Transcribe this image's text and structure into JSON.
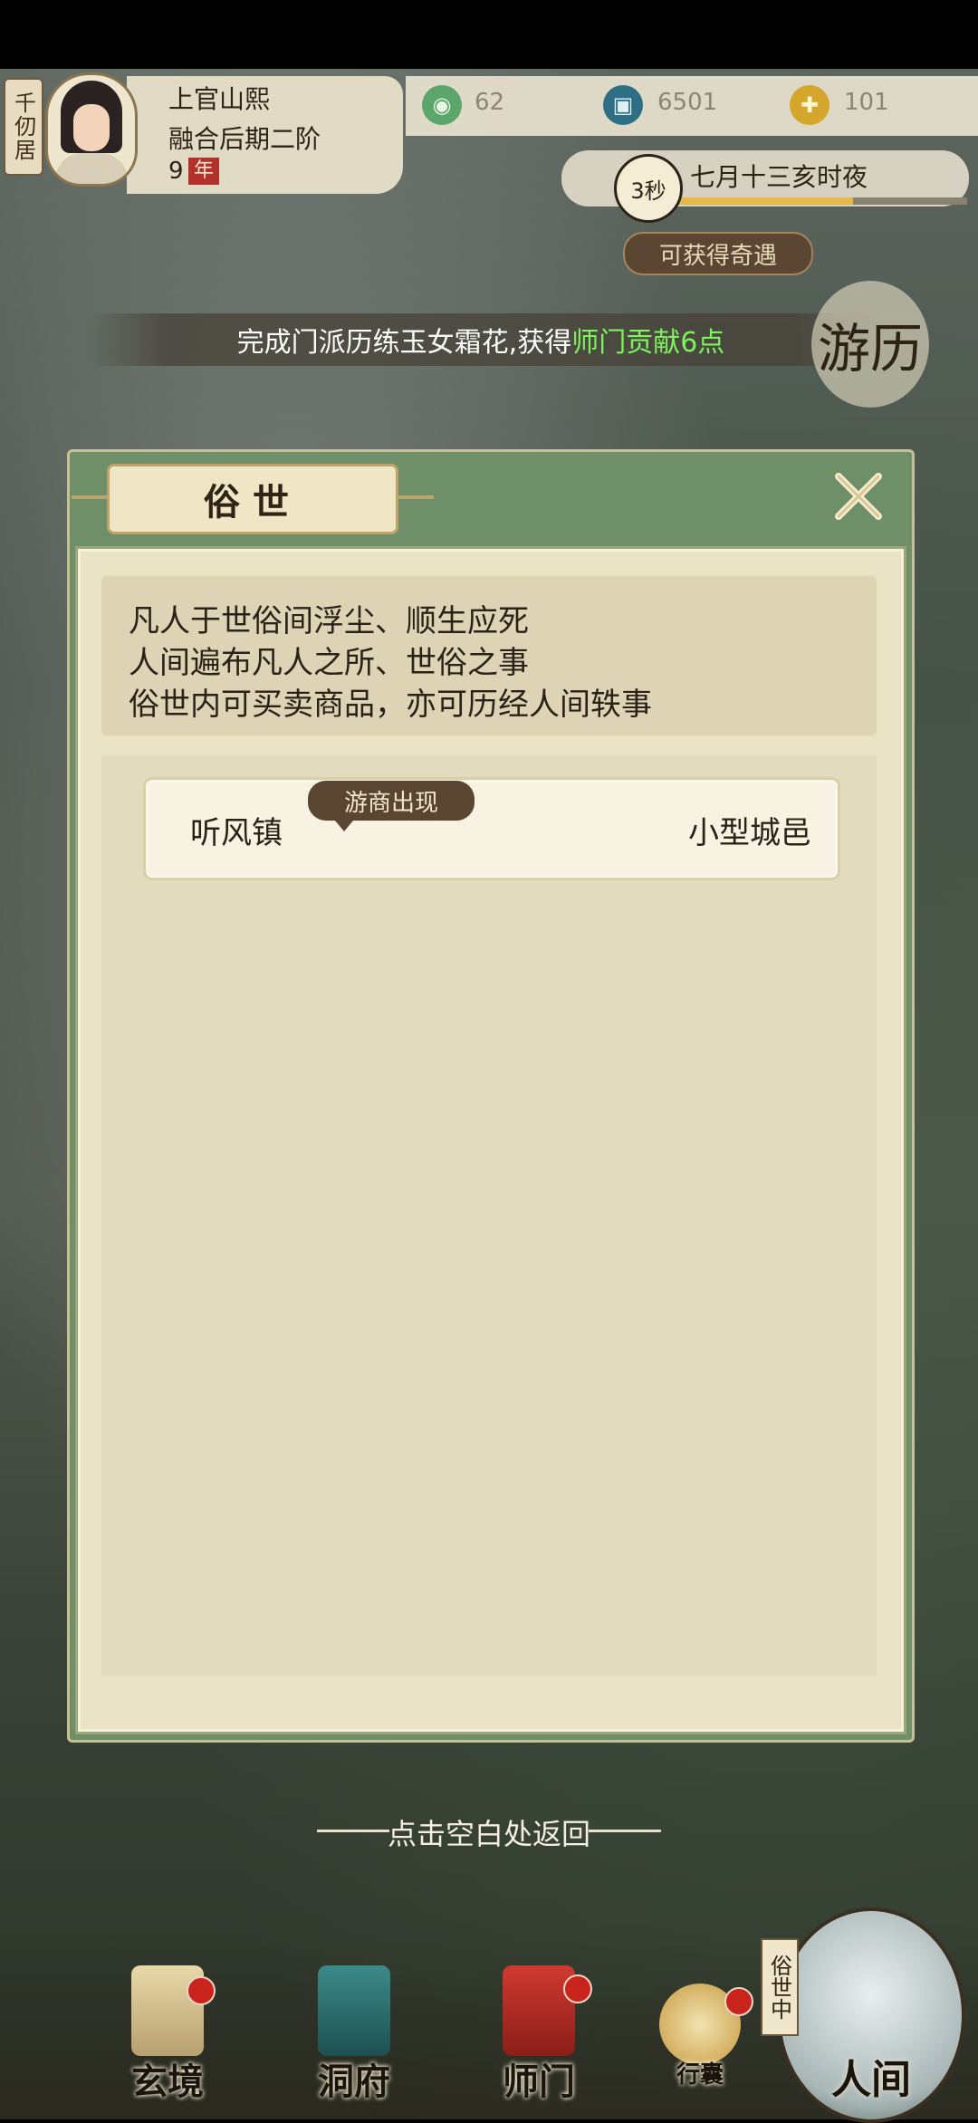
{
  "player": {
    "residence": "千仞居",
    "name": "上官山熙",
    "rank": "融合后期二阶",
    "years": "9",
    "year_unit": "年"
  },
  "resources": [
    {
      "icon": "jade-coin-icon",
      "value": "62",
      "color": "#5aa66b"
    },
    {
      "icon": "spirit-stone-icon",
      "value": "6501",
      "color": "#2f6f86"
    },
    {
      "icon": "contribution-icon",
      "value": "101",
      "color": "#d4a72c"
    }
  ],
  "time": {
    "countdown": "3秒",
    "date": "七月十三亥时夜",
    "progress": 0.6,
    "encounter_button": "可获得奇遇"
  },
  "notice": {
    "text": "完成门派历练玉女霜花,获得",
    "highlight": "师门贡献6点"
  },
  "travel_seal": "游历",
  "modal": {
    "title": "俗世",
    "description": [
      "凡人于世俗间浮尘、顺生应死",
      "人间遍布凡人之所、世俗之事",
      "俗世内可买卖商品，亦可历经人间轶事"
    ],
    "towns": [
      {
        "name": "听风镇",
        "tag": "游商出现",
        "type": "小型城邑"
      }
    ]
  },
  "hint": "点击空白处返回",
  "nav": {
    "items": [
      {
        "label": "玄境",
        "badge": true
      },
      {
        "label": "洞府",
        "badge": false
      },
      {
        "label": "师门",
        "badge": true
      },
      {
        "label": "行囊",
        "badge": true
      }
    ],
    "main": {
      "label": "人间",
      "status": "俗世中"
    }
  }
}
